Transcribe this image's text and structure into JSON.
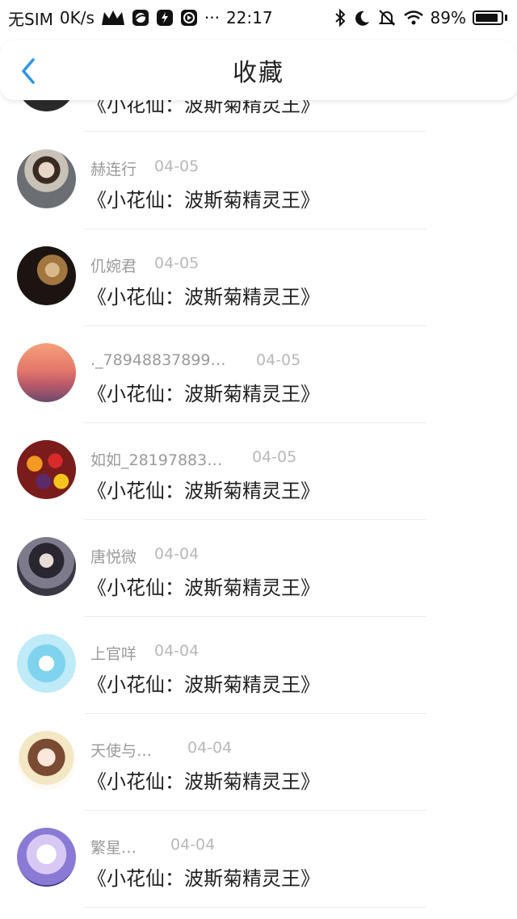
{
  "status_bar": {
    "carrier": "无SIM",
    "speed": "0K/s",
    "dots": "···",
    "time": "22:17",
    "battery": "89%",
    "battery_level": 0.89,
    "icons": [
      "crown-icon",
      "globe-app-icon",
      "bolt-app-icon",
      "play-app-icon",
      "bluetooth-icon",
      "moon-icon",
      "mute-bell-icon",
      "wifi-icon",
      "battery-icon"
    ]
  },
  "nav": {
    "title": "收藏",
    "back_icon": "chevron-left-icon",
    "accent": "#2b95e9"
  },
  "items": [
    {
      "name": "",
      "date": "",
      "title": "《小花仙：波斯菊精灵王》",
      "avatar": "avatar-person-dark"
    },
    {
      "name": "赫连行",
      "date": "04-05",
      "title": "《小花仙：波斯菊精灵王》",
      "avatar": "avatar-girl-photo"
    },
    {
      "name": "仉婉君",
      "date": "04-05",
      "title": "《小花仙：波斯菊精灵王》",
      "avatar": "avatar-dog"
    },
    {
      "name": "._78948837899…",
      "date": "04-05",
      "title": "《小花仙：波斯菊精灵王》",
      "avatar": "avatar-sunset"
    },
    {
      "name": "如如_28197883…",
      "date": "04-05",
      "title": "《小花仙：波斯菊精灵王》",
      "avatar": "avatar-fruits"
    },
    {
      "name": "唐悦微",
      "date": "04-04",
      "title": "《小花仙：波斯菊精灵王》",
      "avatar": "avatar-doll"
    },
    {
      "name": "上官咩",
      "date": "04-04",
      "title": "《小花仙：波斯菊精灵王》",
      "avatar": "avatar-anime-blue"
    },
    {
      "name": "天使与…",
      "date": "04-04",
      "title": "《小花仙：波斯菊精灵王》",
      "avatar": "avatar-anime-girl"
    },
    {
      "name": "繁星…",
      "date": "04-04",
      "title": "《小花仙：波斯菊精灵王》",
      "avatar": "avatar-cat"
    }
  ]
}
